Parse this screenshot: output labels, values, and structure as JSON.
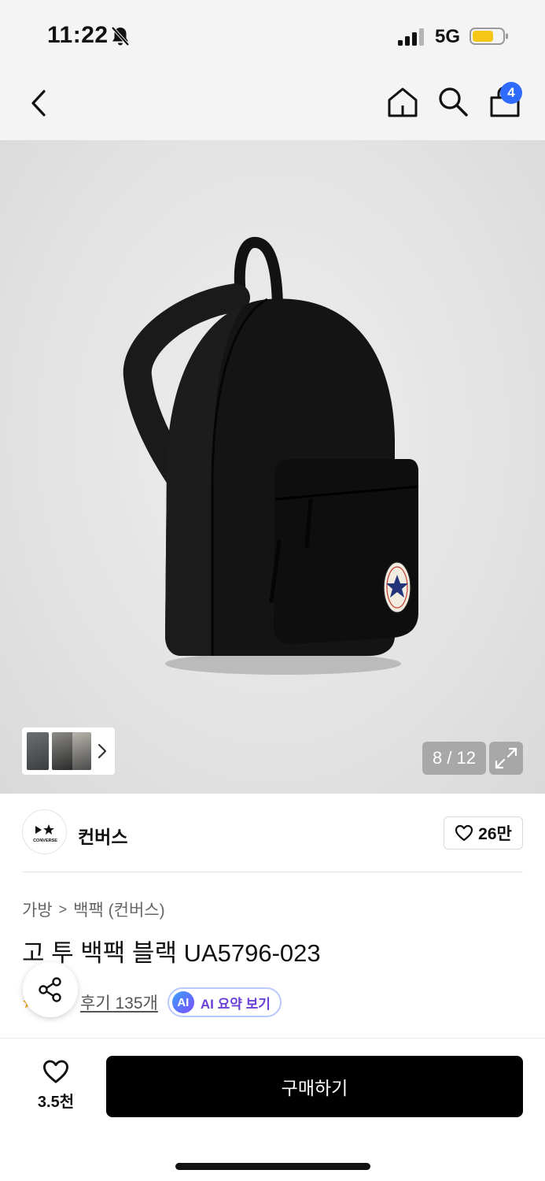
{
  "status_bar": {
    "time": "11:22",
    "network": "5G",
    "battery_color": "#f5c518"
  },
  "nav": {
    "cart_count": "4"
  },
  "gallery": {
    "page_indicator": "8 / 12",
    "current_page": 8,
    "total_pages": 12,
    "logo_text": [
      "CONVERSE",
      "ALL STAR"
    ]
  },
  "brand": {
    "name": "컨버스",
    "logo_text": "CONVERSE",
    "likes": "26만"
  },
  "breadcrumb": {
    "category": "가방",
    "separator": ">",
    "subcategory": "백팩 (컨버스)"
  },
  "product": {
    "title": "고 투 백팩 블랙 UA5796-023"
  },
  "rating": {
    "review_link": "후기 135개",
    "ai_badge": "AI",
    "ai_label": "AI 요약 보기"
  },
  "bottom": {
    "wish_count": "3.5천",
    "buy_label": "구매하기"
  },
  "colors": {
    "accent_blue": "#2f6bff",
    "buy_button": "#000000",
    "ai_purple": "#6a3fd6"
  }
}
